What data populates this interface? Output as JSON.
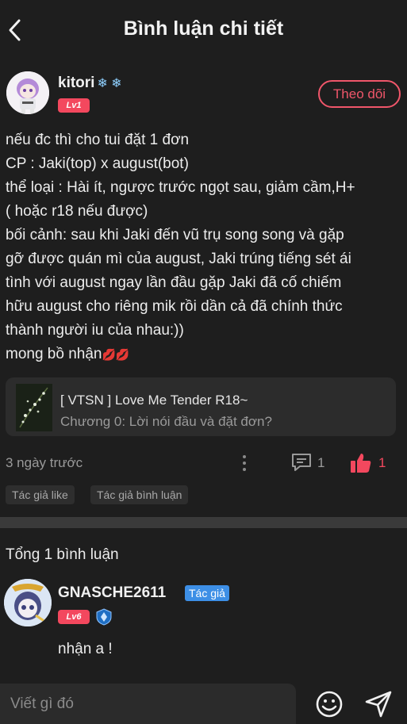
{
  "header": {
    "title": "Bình luận chi tiết"
  },
  "post": {
    "author_name": "kitori",
    "author_level": "Lv1",
    "follow_label": "Theo dõi",
    "body_lines": [
      "nếu đc thì cho tui đặt 1 đơn",
      "CP : Jaki(top) x august(bot)",
      "thể loại : Hài ít, ngược trước ngọt sau, giảm cầm,H+",
      "( hoặc r18 nếu được)",
      "bối cảnh: sau khi Jaki đến vũ trụ song song và gặp",
      "gỡ được quán mì của august, Jaki trúng tiếng sét ái",
      "tình với august ngay lần đầu gặp Jaki đã cố chiếm",
      "hữu august cho riêng mik rồi dần cả đã chính thức",
      "thành người iu của nhau:))",
      "mong bồ nhận"
    ],
    "chapter": {
      "title": "[ VTSN ] Love Me Tender R18~",
      "subtitle": "Chương 0: Lời nói đầu và đặt đơn?"
    },
    "time": "3 ngày trước",
    "comment_count": "1",
    "like_count": "1",
    "tags": [
      "Tác giả like",
      "Tác giả bình luận"
    ]
  },
  "comments": {
    "total_label": "Tổng 1 bình luận",
    "items": [
      {
        "name": "GNASCHE2611",
        "badge": "Tác giả",
        "level": "Lv6",
        "text": "nhận a !"
      }
    ]
  },
  "input": {
    "placeholder": "Viết gì đó"
  },
  "colors": {
    "background": "#1e1e1e",
    "accent": "#f3485e",
    "author_badge": "#3d8fe6"
  },
  "icons": [
    "back-icon",
    "snowflake-icon",
    "more-vertical-icon",
    "comment-icon",
    "thumbs-up-icon",
    "shield-icon",
    "emoji-icon",
    "send-icon"
  ]
}
